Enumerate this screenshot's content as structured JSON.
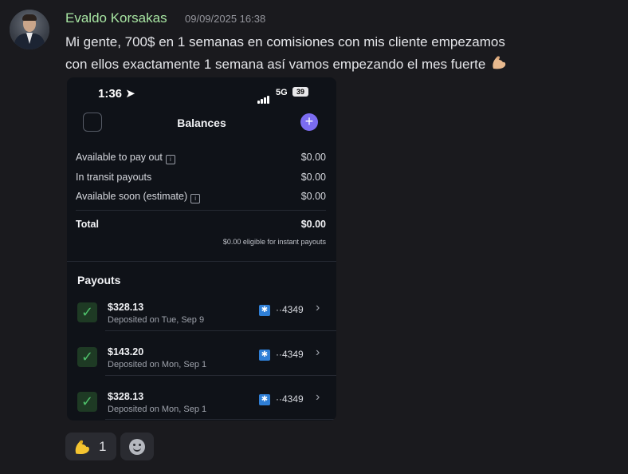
{
  "message": {
    "author": "Evaldo Korsakas",
    "timestamp": "09/09/2025 16:38",
    "text": "Mi gente, 700$ en 1 semanas en comisiones con mis cliente empezamos con ellos exactamente 1 semana así vamos empezando el mes fuerte",
    "trailing_emoji": "flexed-biceps"
  },
  "phone": {
    "status_time": "1:36",
    "network": "5G",
    "battery": "39",
    "header_title": "Balances",
    "balances": [
      {
        "label": "Available to pay out",
        "value": "$0.00",
        "info": true
      },
      {
        "label": "In transit payouts",
        "value": "$0.00",
        "info": false
      },
      {
        "label": "Available soon (estimate)",
        "value": "$0.00",
        "info": true
      }
    ],
    "total_label": "Total",
    "total_value": "$0.00",
    "eligible_note": "$0.00 eligible for instant payouts",
    "payouts_title": "Payouts",
    "payouts": [
      {
        "amount": "$328.13",
        "date": "Deposited on Tue, Sep 9",
        "account": "··4349"
      },
      {
        "amount": "$143.20",
        "date": "Deposited on Mon, Sep 1",
        "account": "··4349"
      },
      {
        "amount": "$328.13",
        "date": "Deposited on Mon, Sep 1",
        "account": "··4349"
      }
    ]
  },
  "reactions": [
    {
      "emoji": "flexed-biceps",
      "count": "1"
    },
    {
      "emoji": "add-reaction"
    }
  ],
  "colors": {
    "username": "#a8e6a3",
    "accent_button": "#7b6cf0",
    "check_green": "#4ec06a"
  }
}
